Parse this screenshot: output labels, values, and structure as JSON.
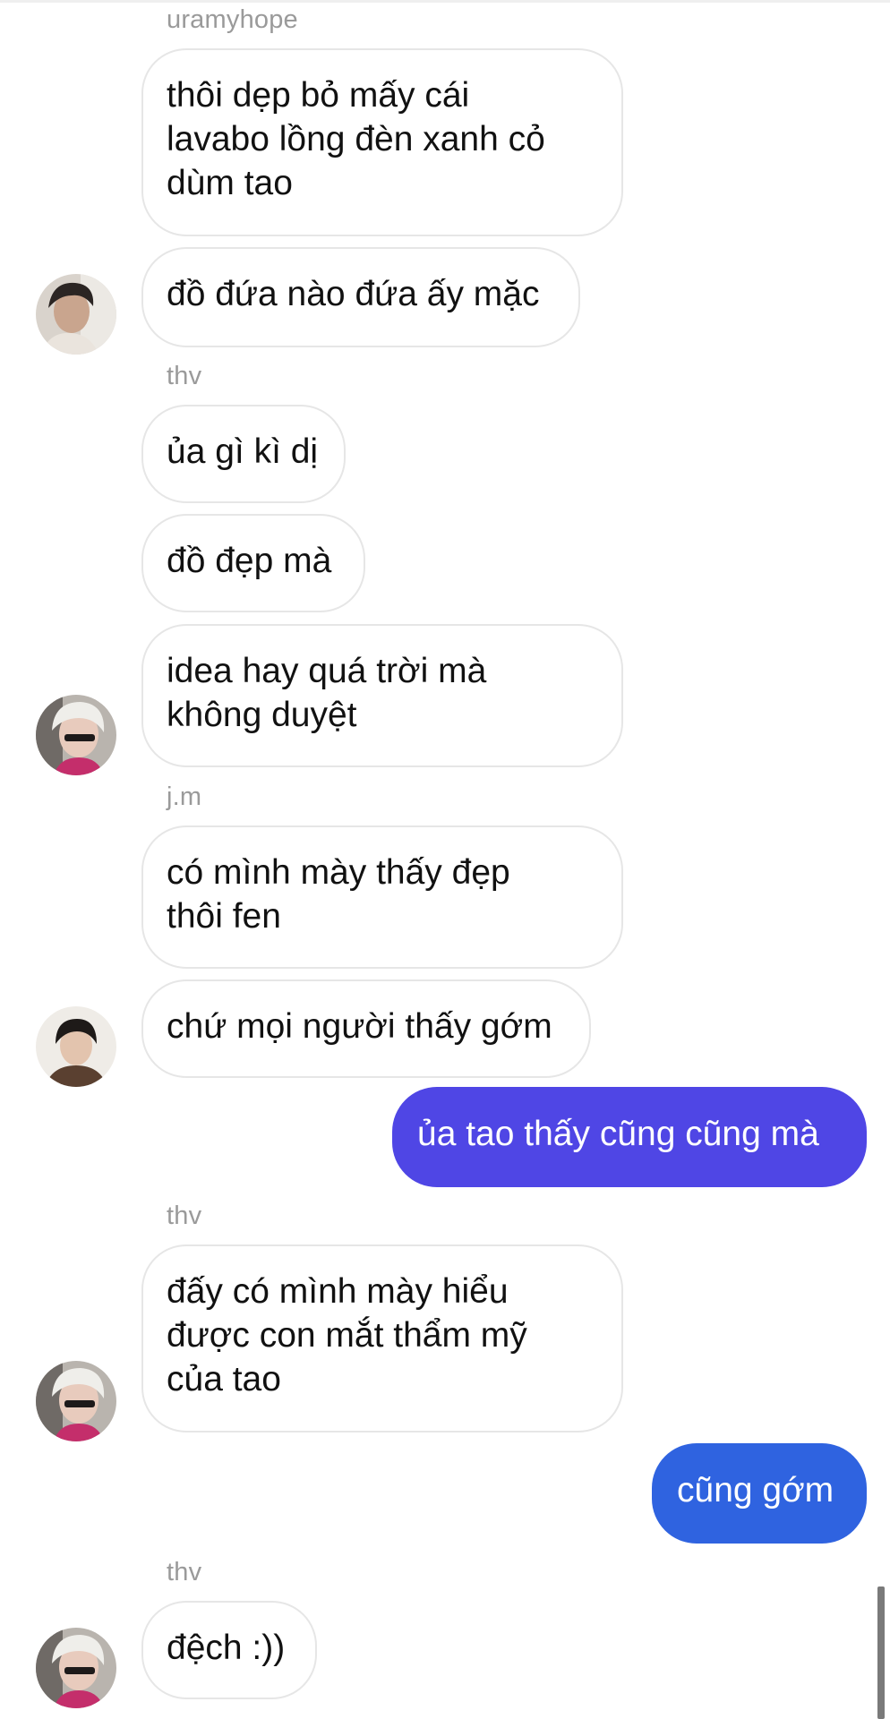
{
  "colors": {
    "outgoing_bubble_1": "#4f46e5",
    "outgoing_bubble_2": "#2f63e0",
    "incoming_border": "#e6e6e6",
    "sender_label": "#9a9a9a"
  },
  "messages": [
    {
      "type": "sender",
      "text": "uramyhope"
    },
    {
      "type": "incoming",
      "lines": [
        "thôi dẹp bỏ mấy cái",
        "lavabo lồng đèn xanh cỏ",
        "dùm tao"
      ]
    },
    {
      "type": "incoming",
      "lines": [
        "đồ đứa nào đứa ấy mặc"
      ],
      "avatar": "avatar-uramyhope"
    },
    {
      "type": "sender",
      "text": "thv"
    },
    {
      "type": "incoming",
      "lines": [
        "ủa gì kì dị"
      ]
    },
    {
      "type": "incoming",
      "lines": [
        "đồ đẹp mà"
      ]
    },
    {
      "type": "incoming",
      "lines": [
        "idea hay quá trời mà",
        "không duyệt"
      ],
      "avatar": "avatar-thv"
    },
    {
      "type": "sender",
      "text": "j.m"
    },
    {
      "type": "incoming",
      "lines": [
        "có mình mày thấy đẹp",
        "thôi fen"
      ]
    },
    {
      "type": "incoming",
      "lines": [
        "chứ mọi người thấy gớm"
      ],
      "avatar": "avatar-jm"
    },
    {
      "type": "outgoing",
      "lines": [
        "ủa tao thấy cũng cũng mà"
      ]
    },
    {
      "type": "sender",
      "text": "thv"
    },
    {
      "type": "incoming",
      "lines": [
        "đấy có mình mày hiểu",
        "được con mắt thẩm mỹ",
        "của tao"
      ],
      "avatar": "avatar-thv"
    },
    {
      "type": "outgoing",
      "lines": [
        "cũng gớm"
      ]
    },
    {
      "type": "sender",
      "text": "thv"
    },
    {
      "type": "incoming",
      "lines": [
        "đệch :))"
      ],
      "avatar": "avatar-thv"
    }
  ]
}
